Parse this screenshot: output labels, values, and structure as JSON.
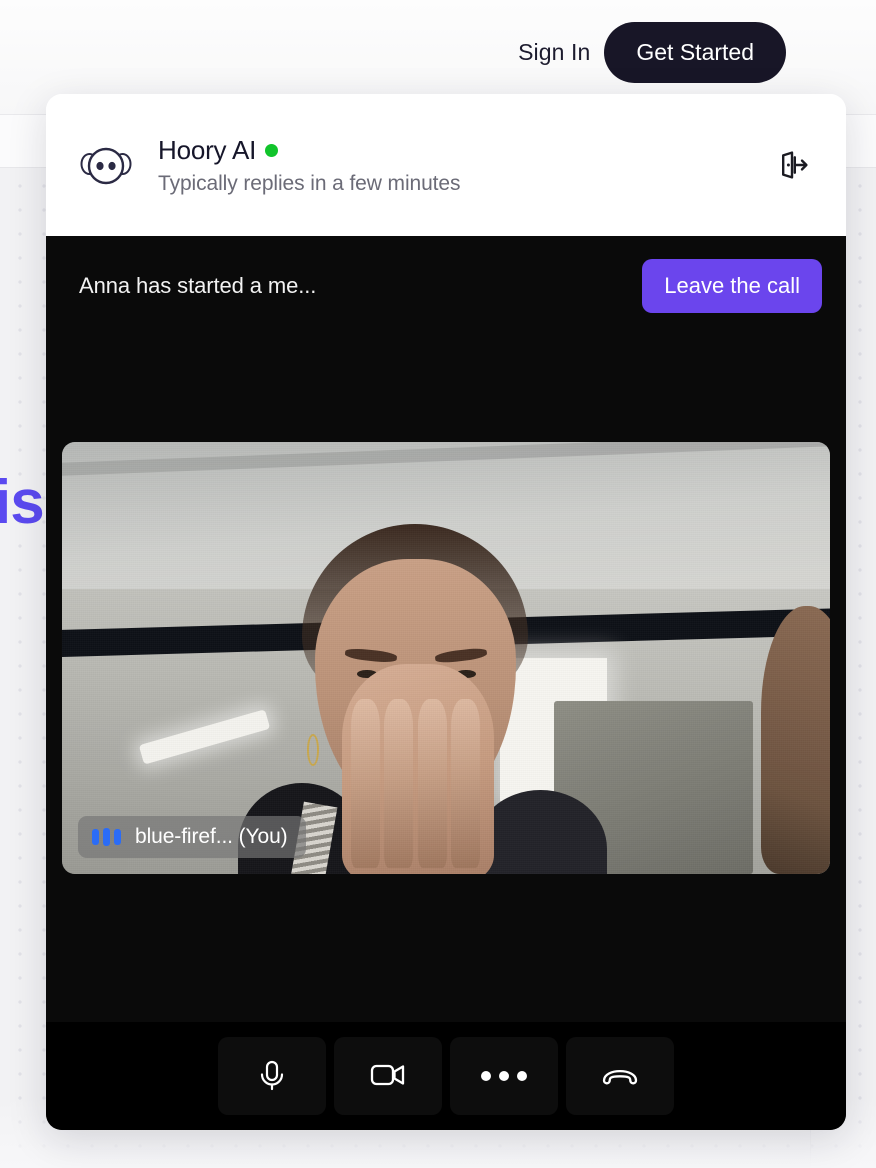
{
  "site": {
    "hero_fragment": "is",
    "nav": {
      "signin_label": "Sign In",
      "cta_label": "Get Started"
    }
  },
  "widget": {
    "header": {
      "avatar_icon": "hoory-face-icon",
      "agent_name": "Hoory AI",
      "status": "online",
      "status_color": "#11c42b",
      "subtitle": "Typically replies in a few minutes",
      "exit_icon": "exit-door-arrow-icon"
    },
    "call": {
      "banner_text": "Anna has started a me...",
      "leave_label": "Leave the call",
      "leave_color": "#6b45ed",
      "participant": {
        "name_label": "blue-firef... (You)",
        "audio_level_icon": "audio-level-bars-icon",
        "audio_level_color": "#2b6cf6"
      },
      "controls": [
        {
          "icon": "microphone-icon",
          "name": "toggle-microphone-button"
        },
        {
          "icon": "video-camera-icon",
          "name": "toggle-camera-button"
        },
        {
          "icon": "more-options-icon",
          "name": "more-options-button"
        },
        {
          "icon": "hang-up-icon",
          "name": "hang-up-button"
        }
      ]
    }
  }
}
